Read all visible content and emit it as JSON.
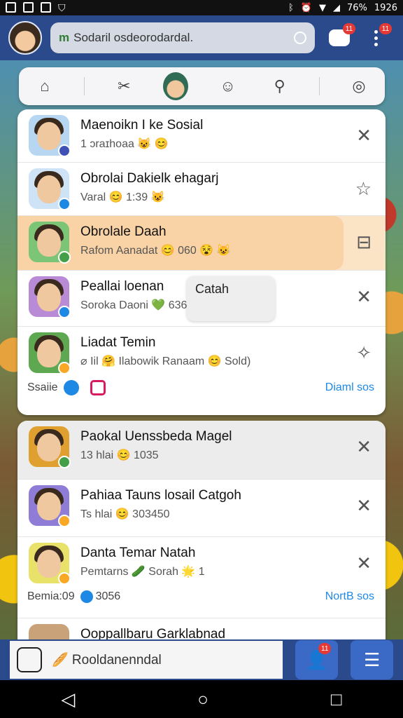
{
  "status_bar": {
    "battery": "76%",
    "time": "1926"
  },
  "header": {
    "search_logo": "m",
    "search_placeholder": "Sodaril osdeorodardal.",
    "chat_badge": "11",
    "menu_badge": "11"
  },
  "card1": {
    "rows": [
      {
        "title": "Maenoikn I ke Sosial",
        "subtitle": "1 ɔraɪhoaa 😺 😊"
      },
      {
        "title": "Obrolai Dakielk ehagarj",
        "subtitle": "Varal 😊 1:39 😺"
      },
      {
        "title": "Obrolale Daah",
        "subtitle": "Rafom Aanadat 😊 060 😵 😺"
      },
      {
        "title": "Peallai loenan",
        "subtitle": "Soroka Daoni 💚 6368 😵 😺",
        "popup": "Catah"
      },
      {
        "title": "Liadat Temin",
        "subtitle": "⌀ Iil 🤗 Ilabowik Ranaam 😊 Sold)",
        "meta_left": "Ssaiie",
        "meta_link": "Diaml sos"
      }
    ]
  },
  "card2": {
    "rows": [
      {
        "title": "Paokal Uenssbeda Magel",
        "subtitle": "13 hlai 😊 1035"
      },
      {
        "title": "Pahiaa Tauns losail Catgoh",
        "subtitle": "Ts hlai 😊 303450"
      },
      {
        "title": "Danta Temar Natah",
        "subtitle": "Pemtarns 🥒 Sorah 🌟 1",
        "meta_left": "Bemia:09",
        "meta_mid": "3056",
        "meta_link": "NortB sos"
      },
      {
        "title": "Ooppallbaru Garklabnad",
        "subtitle": ""
      }
    ]
  },
  "bottom_bar": {
    "input_text": "🥖 Rooldanenndal",
    "profile_badge": "11"
  }
}
